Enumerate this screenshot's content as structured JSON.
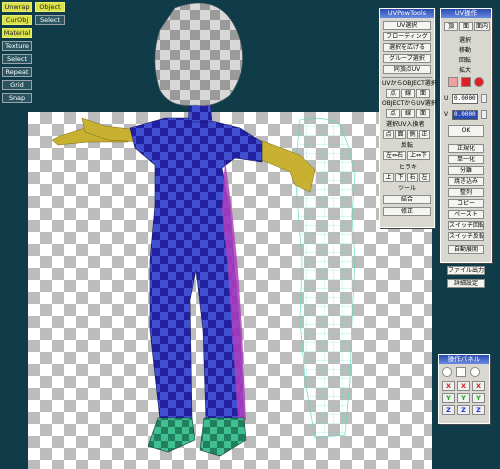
{
  "toolbar": {
    "unwrap": "Unwrap",
    "object": "Object",
    "curobj": "CurObj",
    "select": "Select",
    "material": "Material",
    "texture": "Texture",
    "select2": "Select",
    "repeat": "Repeat",
    "grid": "Grid",
    "snap": "Snap"
  },
  "uvpow": {
    "title": "UVPowTools",
    "uv_select": "UV選択",
    "floating": "フローティング",
    "expand": "選択を広げる",
    "group": "グループ選択",
    "same_uv": "同頂点UV",
    "uv_to_obj": "UVからOBJECT選択",
    "obj_to_uv": "OBJECTからUV選択",
    "pt": "点",
    "line": "線",
    "face": "面",
    "uv_swap": "選択UV入換者",
    "pt2": "点",
    "face2": "面",
    "side": "側",
    "pos": "正",
    "flip": "反転",
    "lr": "左⇔右",
    "ud": "上⇔下",
    "align": "ヒラキ",
    "up": "上",
    "down": "下",
    "right": "右",
    "left": "左",
    "tool": "ツール",
    "merge": "結合",
    "fix": "修正"
  },
  "uvop": {
    "title": "UV操作",
    "tab_point": "頂",
    "tab_face": "面",
    "tab_surface": "面内",
    "select": "選択",
    "move": "移動",
    "rotate": "回転",
    "scale": "拡大",
    "u_label": "U",
    "u_value": "0.0000",
    "v_label": "V",
    "v_value": "0.0000",
    "ok": "OK",
    "normalize": "正規化",
    "single": "単一化",
    "split": "分離",
    "overwrite": "焼き込み",
    "arrange": "整列",
    "copy": "コピー",
    "paste": "ペースト",
    "switch_rot": "スイッチ回転",
    "switch_flip": "スイッチ反転",
    "auto_unfold": "自動展開",
    "file_out": "ファイル出力",
    "details": "詳細設定"
  },
  "oppanel": {
    "title": "操作パネル",
    "x": "X",
    "y": "Y",
    "z": "Z"
  }
}
